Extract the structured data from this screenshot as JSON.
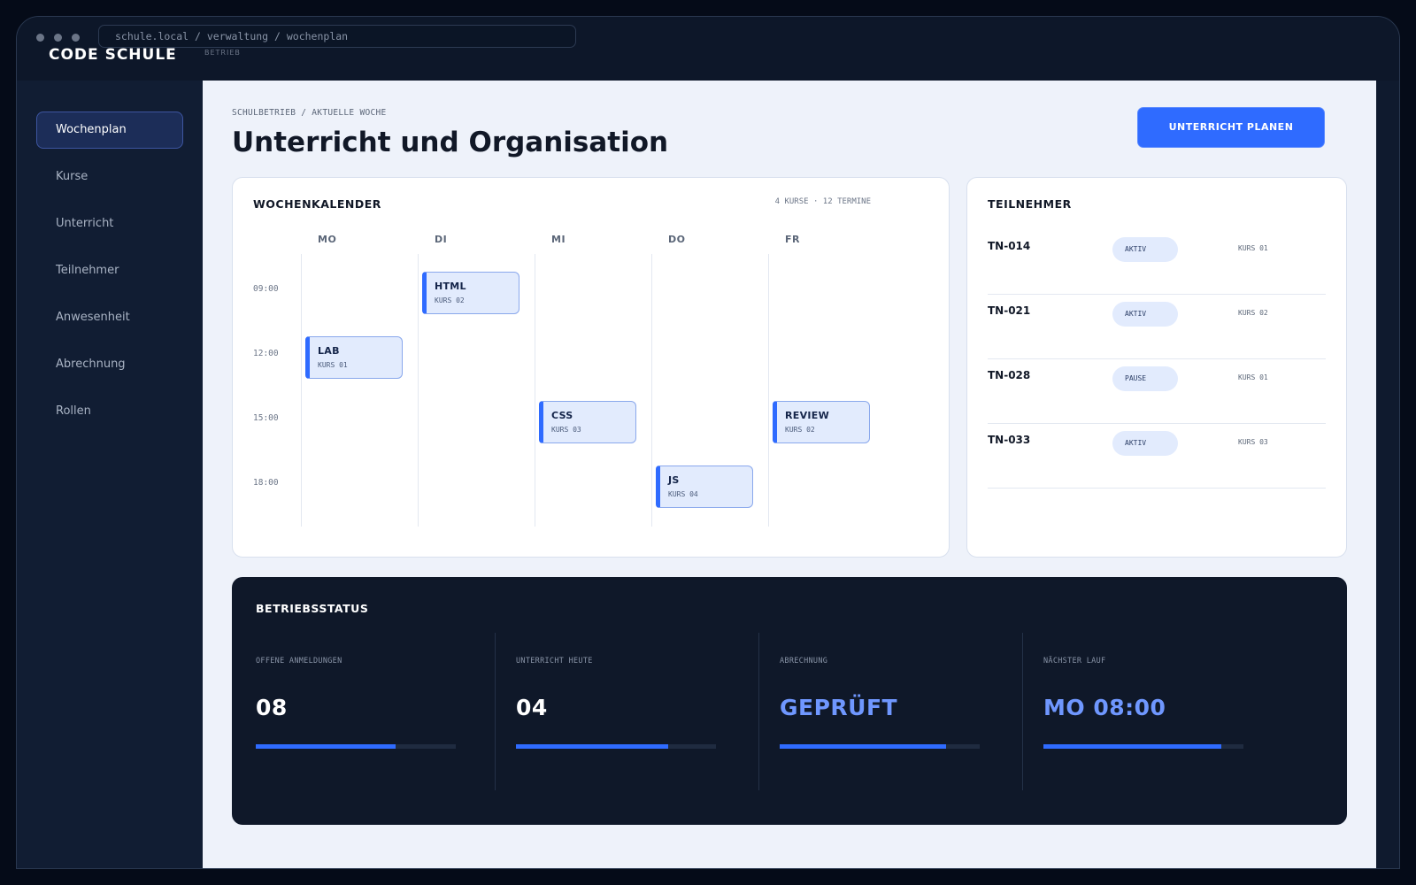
{
  "browser": {
    "url": "schule.local / verwaltung / wochenplan"
  },
  "app": {
    "brand": "CODE SCHULE",
    "brand_sub": "BETRIEB"
  },
  "sidebar": {
    "items": [
      {
        "label": "Wochenplan",
        "active": true
      },
      {
        "label": "Kurse",
        "active": false
      },
      {
        "label": "Unterricht",
        "active": false
      },
      {
        "label": "Teilnehmer",
        "active": false
      },
      {
        "label": "Anwesenheit",
        "active": false
      },
      {
        "label": "Abrechnung",
        "active": false
      },
      {
        "label": "Rollen",
        "active": false
      }
    ]
  },
  "header": {
    "breadcrumb": "SCHULBETRIEB / AKTUELLE WOCHE",
    "title": "Unterricht und Organisation",
    "action_label": "UNTERRICHT PLANEN"
  },
  "calendar": {
    "title": "WOCHENKALENDER",
    "meta": "4 KURSE · 12 TERMINE",
    "days": [
      "MO",
      "DI",
      "MI",
      "DO",
      "FR"
    ],
    "times": [
      "09:00",
      "12:00",
      "15:00",
      "18:00"
    ],
    "events": [
      {
        "title": "HTML",
        "course": "KURS 02",
        "day": "DI",
        "time": "09:00"
      },
      {
        "title": "LAB",
        "course": "KURS 01",
        "day": "MO",
        "time": "12:00"
      },
      {
        "title": "CSS",
        "course": "KURS 03",
        "day": "MI",
        "time": "15:00"
      },
      {
        "title": "REVIEW",
        "course": "KURS 02",
        "day": "FR",
        "time": "15:00"
      },
      {
        "title": "JS",
        "course": "KURS 04",
        "day": "DO",
        "time": "18:00"
      }
    ]
  },
  "participants": {
    "title": "TEILNEHMER",
    "rows": [
      {
        "id": "TN-014",
        "status": "AKTIV",
        "course": "KURS 01"
      },
      {
        "id": "TN-021",
        "status": "AKTIV",
        "course": "KURS 02"
      },
      {
        "id": "TN-028",
        "status": "PAUSE",
        "course": "KURS 01"
      },
      {
        "id": "TN-033",
        "status": "AKTIV",
        "course": "KURS 03"
      }
    ]
  },
  "status": {
    "title": "BETRIEBSSTATUS",
    "metrics": [
      {
        "label": "OFFENE ANMELDUNGEN",
        "value": "08",
        "progress": 0.7,
        "value_color": "#ffffff"
      },
      {
        "label": "UNTERRICHT HEUTE",
        "value": "04",
        "progress": 0.76,
        "value_color": "#ffffff"
      },
      {
        "label": "ABRECHNUNG",
        "value": "GEPRÜFT",
        "progress": 0.83,
        "value_color": "#6f97ff"
      },
      {
        "label": "NÄCHSTER LAUF",
        "value": "MO 08:00",
        "progress": 0.89,
        "value_color": "#6f97ff"
      }
    ]
  },
  "colors": {
    "accent": "#2f6bff",
    "sidebar": "#111d33",
    "background": "#eef2fa"
  }
}
